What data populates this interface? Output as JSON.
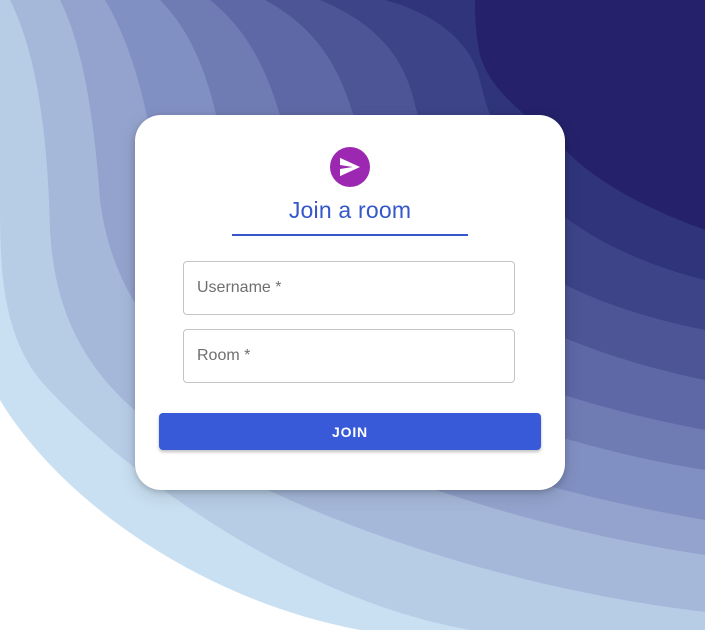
{
  "background": {
    "colors": [
      "#c9e0f2",
      "#b6cde6",
      "#a3b6d8",
      "#91a2cc",
      "#7f8bbd",
      "#6d76ad",
      "#5a629d",
      "#4a518e",
      "#3a3f7f",
      "#2c2f70",
      "#24226a"
    ]
  },
  "card": {
    "logo_icon": "send-icon",
    "logo_color": "#9c27b0",
    "title": "Join a room",
    "accent_color": "#3557c9"
  },
  "form": {
    "username_placeholder": "Username *",
    "username_value": "",
    "room_placeholder": "Room *",
    "room_value": "",
    "join_label": "JOIN",
    "join_color": "#385ad8"
  }
}
